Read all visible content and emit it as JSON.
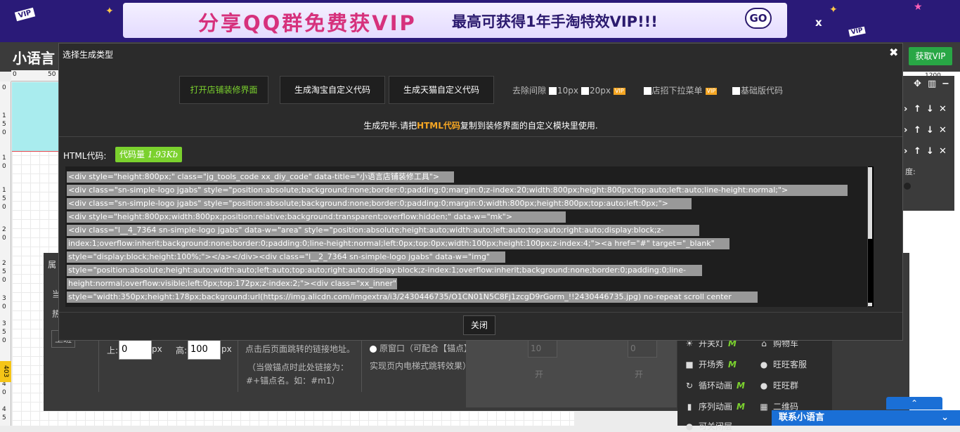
{
  "banner": {
    "main_text": "分享QQ群免费获VIP",
    "sub_text": "最高可获得1年手淘特效VIP!!!",
    "go": "GO",
    "close": "x",
    "tag_left": "VIP",
    "tag_right": "VIP"
  },
  "app": {
    "logo": "小语言",
    "get_vip": "获取VIP"
  },
  "rulers": {
    "h": [
      "0",
      "50",
      "1200"
    ],
    "v": [
      "0",
      "1",
      "5",
      "0",
      "1",
      "0",
      "1",
      "5",
      "0",
      "2",
      "0",
      "2",
      "5",
      "0",
      "3",
      "0",
      "3",
      "5",
      "0",
      "4",
      "0",
      "4",
      "5"
    ],
    "marker": "403"
  },
  "right_panel": {
    "height_label": "度:"
  },
  "property_panel": {
    "title": "属",
    "left_labels": [
      "当",
      "热"
    ],
    "left_btn": "上班",
    "top_label": "上:",
    "top_value": "0",
    "top_unit": "px",
    "height_label": "高:",
    "height_value": "100",
    "height_unit": "px",
    "hint": "点击后页面跳转的链接地址。",
    "hint2": "（当做锚点时此处链接为：",
    "hint3": "#+锚点名。如：#m1）",
    "radio_label": "原窗口（可配合【锚点】工具",
    "radio_label2": "实现页内电梯式跳转效果）",
    "gray_box1": "10",
    "gray_box2": "0",
    "toggle1": "开",
    "toggle2": "开"
  },
  "modules": {
    "items": [
      {
        "icon": "☀",
        "label": "开关灯",
        "m": "M",
        "icon2": "⌂",
        "label2": "购物车"
      },
      {
        "icon": "■",
        "label": "开场秀",
        "m": "M",
        "icon2": "●",
        "label2": "旺旺客服"
      },
      {
        "icon": "↻",
        "label": "循环动画",
        "m": "M",
        "icon2": "●",
        "label2": "旺旺群"
      },
      {
        "icon": "▮",
        "label": "序列动画",
        "m": "M",
        "icon2": "▦",
        "label2": "二维码"
      },
      {
        "icon": "●",
        "label": "可关闭层",
        "m": "",
        "icon2": "●",
        "label2": ""
      }
    ]
  },
  "contact": {
    "label": "联系小语言",
    "chevron": "⌄",
    "up": "⌃"
  },
  "modal": {
    "title": "选择生成类型",
    "close": "✖",
    "btn_open": "打开店铺装修界面",
    "btn_taobao": "生成淘宝自定义代码",
    "btn_tmall": "生成天猫自定义代码",
    "opt_remove_gap": "去除间隙",
    "opt_10": "10px",
    "opt_20": "20px",
    "opt_menu": "店招下拉菜单",
    "opt_basic": "基础版代码",
    "vip": "VIP",
    "msg_pre": "生成完毕.请把",
    "msg_hl": "HTML代码",
    "msg_post": "复制到装修界面的自定义模块里使用.",
    "code_label": "HTML代码:",
    "size_label": "代码量",
    "size_value": "1.93Kb",
    "code_lines": [
      "<div style=\"height:800px;\" class=\"jg_tools_code xx_diy_code\"  data-title=\"小语言店铺装修工具\">",
      "  <div class=\"sn-simple-logo jgabs\" style=\"position:absolute;background:none;border:0;padding:0;margin:0;z-index:20;width:800px;height:800px;top:auto;left:auto;line-height:normal;\">",
      "    <div class=\"sn-simple-logo jgabs\" style=\"position:absolute;background:none;border:0;padding:0;margin:0;width:800px;height:800px;top:auto;left:0px;\">",
      "                <div style=\"height:800px;width:800px;position:relative;background:transparent;overflow:hidden;\" data-w=\"mk\">",
      "          <div class=\"l__4_7364 sn-simple-logo jgabs\" data-w=\"area\" style=\"position:absolute;height:auto;width:auto;left:auto;top:auto;right:auto;display:block;z-",
      "index:1;overflow:inherit;background:none;border:0;padding:0;line-height:normal;left:0px;top:0px;width:100px;height:100px;z-index:4;\"><a href=\"#\" target=\"_blank\"",
      "style=\"display:block;height:100%;\"></a></div><div class=\"l__2_7364 sn-simple-logo jgabs\" data-w=\"img\"",
      "style=\"position:absolute;height:auto;width:auto;left:auto;top:auto;right:auto;display:block;z-index:1;overflow:inherit;background:none;border:0;padding:0;line-",
      "height:normal;overflow:visible;left:0px;top:172px;z-index:2;\"><div class=\"xx_inner\"",
      "style=\"width:350px;height:178px;background:url(https://img.alicdn.com/imgextra/i3/2430446735/O1CN01N5C8Fj1zcgD9rGorm_!!2430446735.jpg) no-repeat scroll center"
    ],
    "close_btn": "关闭"
  }
}
